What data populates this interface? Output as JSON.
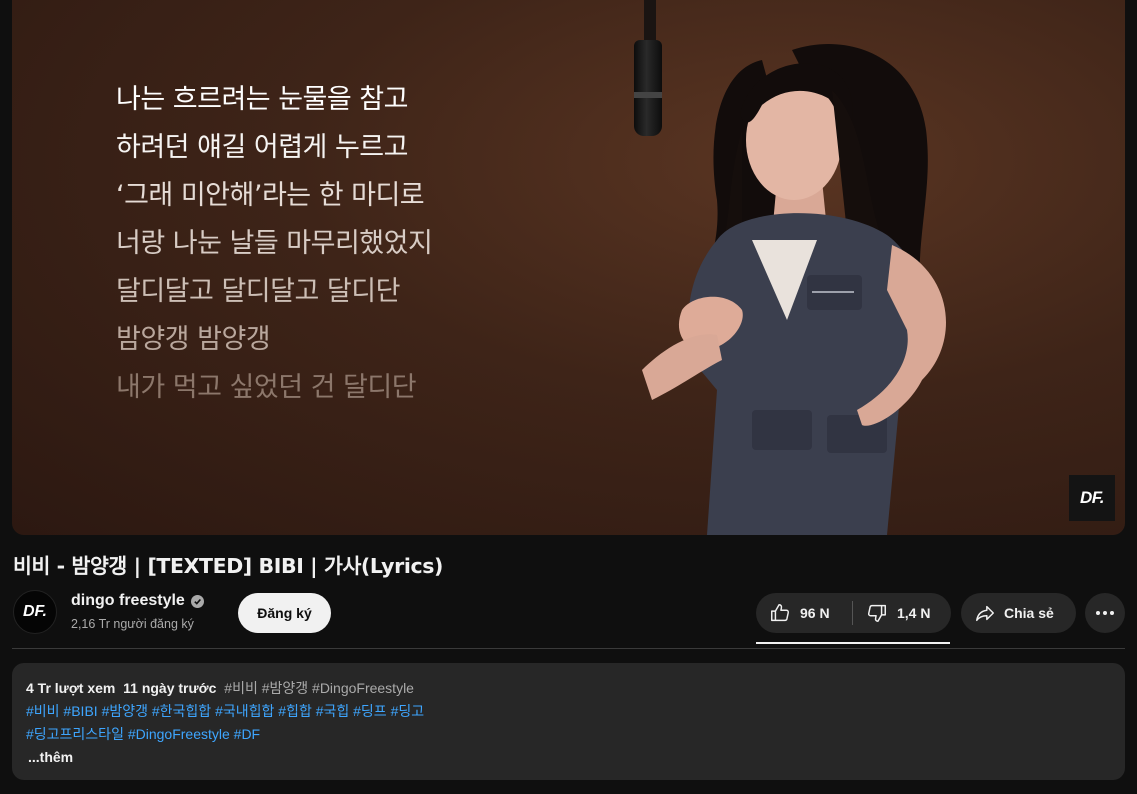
{
  "player": {
    "lyrics": [
      "나는 흐르려는 눈물을 참고",
      "하려던 얘길 어렵게 누르고",
      "‘그래 미안해’라는 한 마디로",
      "너랑 나눈 날들 마무리했었지",
      "달디달고 달디달고 달디단",
      "밤양갱 밤양갱",
      "내가 먹고 싶었던 건 달디단"
    ],
    "watermark": "DF."
  },
  "video": {
    "title": "비비 - 밤양갱 | [TEXTED] BIBI | 가사(Lyrics)"
  },
  "channel": {
    "avatar_text": "DF.",
    "name": "dingo freestyle",
    "subscribers": "2,16 Tr người đăng ký",
    "subscribe_label": "Đăng ký"
  },
  "actions": {
    "like_count": "96 N",
    "dislike_count": "1,4 N",
    "share_label": "Chia sẻ"
  },
  "description": {
    "views": "4 Tr lượt xem",
    "age": "11 ngày trước",
    "inline_tags": "#비비 #밤양갱 #DingoFreestyle",
    "tag_line_1": "#비비 #BIBI #밤양갱 #한국힙합 #국내힙합 #힙합 #국힙 #딩프 #딩고",
    "tag_line_2": "#딩고프리스타일 #DingoFreestyle #DF",
    "more_label": "...thêm"
  },
  "colors": {
    "page_bg": "#0f0f0f",
    "surface": "#272727",
    "link": "#3ea6ff",
    "text_primary": "#f1f1f1",
    "text_secondary": "#aaaaaa"
  }
}
